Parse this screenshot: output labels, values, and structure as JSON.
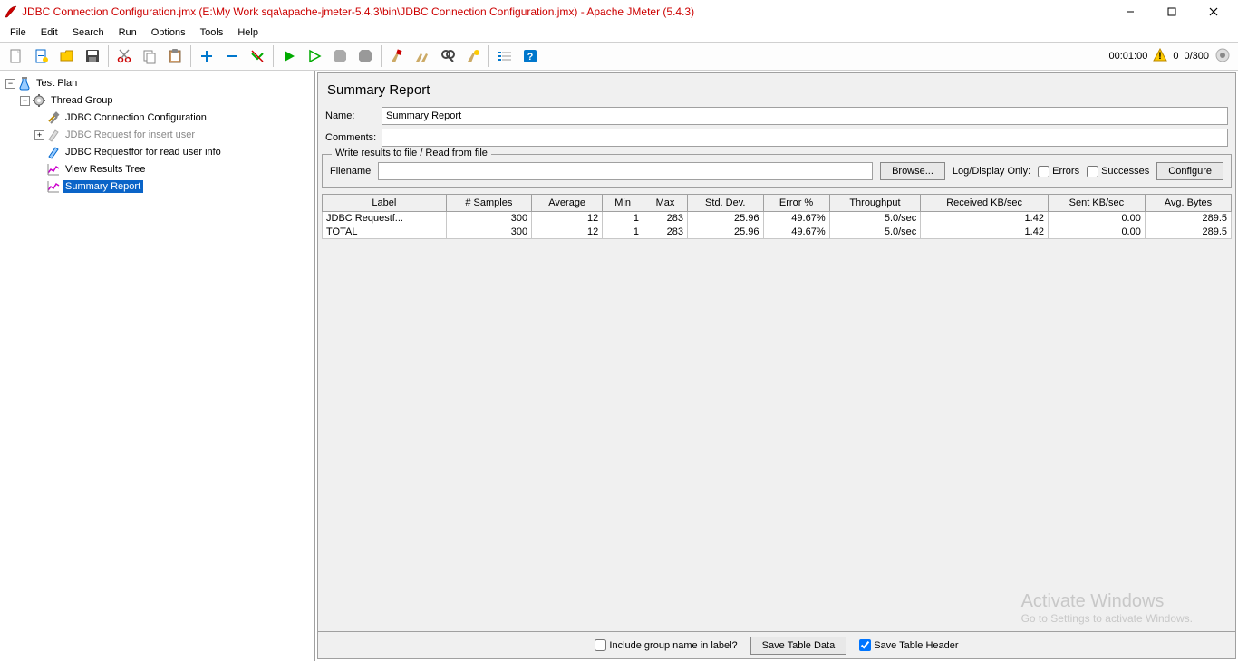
{
  "window": {
    "title": "JDBC Connection Configuration.jmx (E:\\My Work sqa\\apache-jmeter-5.4.3\\bin\\JDBC Connection Configuration.jmx) - Apache JMeter (5.4.3)"
  },
  "menu": {
    "file": "File",
    "edit": "Edit",
    "search": "Search",
    "run": "Run",
    "options": "Options",
    "tools": "Tools",
    "help": "Help"
  },
  "status": {
    "time": "00:01:00",
    "warn_count": "0",
    "threads": "0/300"
  },
  "tree": {
    "test_plan": "Test Plan",
    "thread_group": "Thread Group",
    "jdbc_conn": "JDBC Connection Configuration",
    "jdbc_insert": "JDBC Request for insert user",
    "jdbc_read": "JDBC Requestfor for read user info",
    "view_results": "View Results Tree",
    "summary_report": "Summary Report"
  },
  "panel": {
    "title": "Summary Report",
    "name_label": "Name:",
    "name_value": "Summary Report",
    "comments_label": "Comments:",
    "comments_value": "",
    "group_legend": "Write results to file / Read from file",
    "filename_label": "Filename",
    "filename_value": "",
    "browse": "Browse...",
    "log_display": "Log/Display Only:",
    "errors": "Errors",
    "successes": "Successes",
    "configure": "Configure"
  },
  "table": {
    "headers": {
      "label": "Label",
      "samples": "# Samples",
      "avg": "Average",
      "min": "Min",
      "max": "Max",
      "stddev": "Std. Dev.",
      "error": "Error %",
      "throughput": "Throughput",
      "recv": "Received KB/sec",
      "sent": "Sent KB/sec",
      "bytes": "Avg. Bytes"
    },
    "rows": [
      {
        "label": "JDBC Requestf...",
        "samples": "300",
        "avg": "12",
        "min": "1",
        "max": "283",
        "stddev": "25.96",
        "error": "49.67%",
        "throughput": "5.0/sec",
        "recv": "1.42",
        "sent": "0.00",
        "bytes": "289.5"
      },
      {
        "label": "TOTAL",
        "samples": "300",
        "avg": "12",
        "min": "1",
        "max": "283",
        "stddev": "25.96",
        "error": "49.67%",
        "throughput": "5.0/sec",
        "recv": "1.42",
        "sent": "0.00",
        "bytes": "289.5"
      }
    ]
  },
  "bottom": {
    "include_group": "Include group name in label?",
    "save_table": "Save Table Data",
    "save_header": "Save Table Header"
  },
  "watermark": {
    "l1": "Activate Windows",
    "l2": "Go to Settings to activate Windows."
  }
}
